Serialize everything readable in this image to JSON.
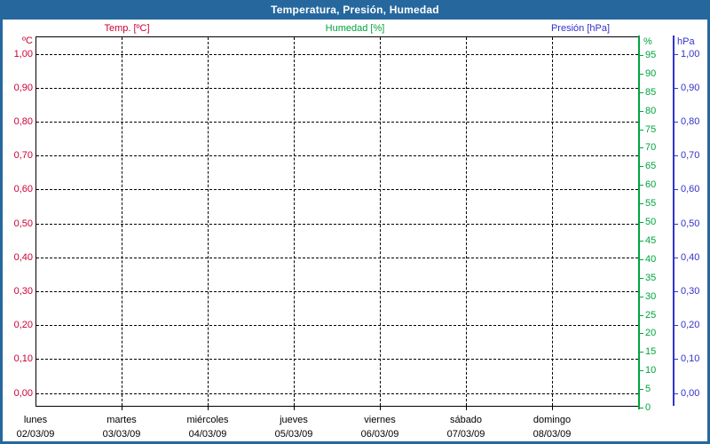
{
  "window": {
    "title": "Temperatura, Presión, Humedad"
  },
  "colors": {
    "titlebar_bg": "#26689e",
    "titlebar_text": "#ffffff",
    "window_border": "#26689e",
    "temp": "#cc0033",
    "humidity": "#00a43e",
    "pressure": "#3232cc",
    "grid": "#000000",
    "axis_frame": "#000000",
    "day_label": "#000000",
    "background": "#ffffff"
  },
  "legend": [
    {
      "label": "Temp. [ºC]",
      "series": "temp"
    },
    {
      "label": "Humedad [%]",
      "series": "humidity"
    },
    {
      "label": "Presión [hPa]",
      "series": "pressure"
    }
  ],
  "axes": {
    "temp": {
      "unit": "ºC",
      "tick_labels": [
        "1,00",
        "0,90",
        "0,80",
        "0,70",
        "0,60",
        "0,50",
        "0,40",
        "0,30",
        "0,20",
        "0,10",
        "0,00"
      ]
    },
    "humidity": {
      "unit": "%",
      "tick_labels": [
        "95",
        "90",
        "85",
        "80",
        "75",
        "70",
        "65",
        "60",
        "55",
        "50",
        "45",
        "40",
        "35",
        "30",
        "25",
        "20",
        "15",
        "10",
        "5",
        "0"
      ]
    },
    "pressure": {
      "unit": "hPa",
      "tick_labels": [
        "1,00",
        "0,90",
        "0,80",
        "0,70",
        "0,60",
        "0,50",
        "0,40",
        "0,30",
        "0,20",
        "0,10",
        "0,00"
      ]
    }
  },
  "x_axis": {
    "days": [
      {
        "name": "lunes",
        "date": "02/03/09"
      },
      {
        "name": "martes",
        "date": "03/03/09"
      },
      {
        "name": "miércoles",
        "date": "04/03/09"
      },
      {
        "name": "jueves",
        "date": "05/03/09"
      },
      {
        "name": "viernes",
        "date": "06/03/09"
      },
      {
        "name": "sábado",
        "date": "07/03/09"
      },
      {
        "name": "domingo",
        "date": "08/03/09"
      }
    ]
  },
  "chart_data": {
    "type": "line",
    "title": "Temperatura, Presión, Humedad",
    "x": [
      "02/03/09",
      "03/03/09",
      "04/03/09",
      "05/03/09",
      "06/03/09",
      "07/03/09",
      "08/03/09"
    ],
    "x_day_names": [
      "lunes",
      "martes",
      "miércoles",
      "jueves",
      "viernes",
      "sábado",
      "domingo"
    ],
    "series": [
      {
        "name": "Temp. [ºC]",
        "axis": "left",
        "color": "#cc0033",
        "values": []
      },
      {
        "name": "Humedad [%]",
        "axis": "right_inner",
        "color": "#00a43e",
        "values": []
      },
      {
        "name": "Presión [hPa]",
        "axis": "right_outer",
        "color": "#3232cc",
        "values": []
      }
    ],
    "left_axis": {
      "label": "ºC",
      "range": [
        0.0,
        1.0
      ],
      "tick_step": 0.1,
      "decimal_separator": ","
    },
    "right_axis_inner": {
      "label": "%",
      "range": [
        0,
        100
      ],
      "tick_step": 5,
      "highest_labeled_tick": 95
    },
    "right_axis_outer": {
      "label": "hPa",
      "range": [
        0.0,
        1.0
      ],
      "tick_step": 0.1,
      "decimal_separator": ","
    },
    "grid": true,
    "grid_style": "dashed",
    "legend_position": "top"
  }
}
